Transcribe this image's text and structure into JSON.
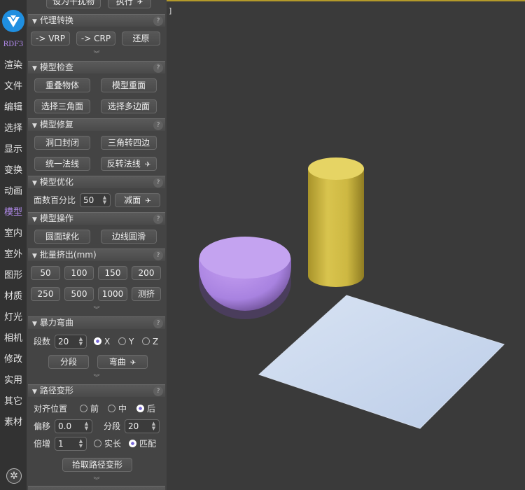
{
  "brand": "RDF3",
  "nav": [
    "渲染",
    "文件",
    "编辑",
    "选择",
    "显示",
    "变换",
    "动画",
    "模型",
    "室内",
    "室外",
    "图形",
    "材质",
    "灯光",
    "相机",
    "修改",
    "实用",
    "其它",
    "素材"
  ],
  "nav_active": "模型",
  "top": {
    "btn_disturb": "设为干扰物",
    "btn_exec": "执行"
  },
  "proxy": {
    "title": "代理转换",
    "vrp": "-> VRP",
    "crp": "-> CRP",
    "restore": "还原"
  },
  "check": {
    "title": "模型检查",
    "overlap": "重叠物体",
    "duplicate_face": "模型重面",
    "select_tri": "选择三角面",
    "select_poly": "选择多边面"
  },
  "repair": {
    "title": "模型修复",
    "cap_holes": "洞口封闭",
    "tri_to_quad": "三角转四边",
    "unify_normals": "统一法线",
    "flip_normals": "反转法线"
  },
  "optimize": {
    "title": "模型优化",
    "percent_label": "面数百分比",
    "percent_value": "50",
    "reduce": "减面"
  },
  "operate": {
    "title": "模型操作",
    "spherify": "圆面球化",
    "edge_round": "边线圆滑"
  },
  "extrude": {
    "title": "批量挤出(mm)",
    "values": [
      "50",
      "100",
      "150",
      "200",
      "250",
      "500",
      "1000"
    ],
    "measure": "测挤"
  },
  "bend": {
    "title": "暴力弯曲",
    "segments_label": "段数",
    "segments_value": "20",
    "axis_x": "X",
    "axis_y": "Y",
    "axis_z": "Z",
    "segment_btn": "分段",
    "bend_btn": "弯曲"
  },
  "path": {
    "title": "路径变形",
    "align_label": "对齐位置",
    "front": "前",
    "middle": "中",
    "back": "后",
    "offset_label": "偏移",
    "offset_value": "0.0",
    "seg_label": "分段",
    "seg_value": "20",
    "mult_label": "倍增",
    "mult_value": "1",
    "real_length": "实长",
    "match": "匹配",
    "pick": "拾取路径变形"
  },
  "help_icon": "?",
  "colors": {
    "accent": "#b48cf0",
    "logo": "#1f8fe0",
    "cylinder": "#d6c24a",
    "sphere": "#b48ae6",
    "plane": "#c4d4ec"
  }
}
